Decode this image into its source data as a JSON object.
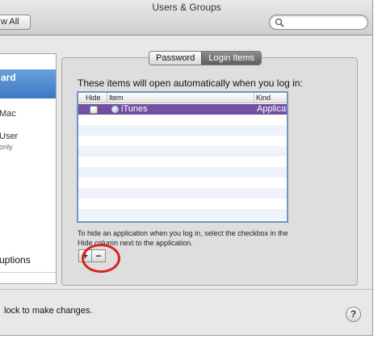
{
  "window": {
    "title": "Users & Groups"
  },
  "toolbar": {
    "show_all_label": "w All",
    "search_icon": "search-icon"
  },
  "sidebar": {
    "selected_label": "ard",
    "items": [
      {
        "label": "Mac",
        "sub": ""
      },
      {
        "label": "User",
        "sub": "only"
      }
    ],
    "options_label": "uptions"
  },
  "tabs": [
    {
      "label": "Password",
      "active": false
    },
    {
      "label": "Login Items",
      "active": true
    }
  ],
  "login_items": {
    "heading": "These items will open automatically when you log in:",
    "columns": [
      "Hide",
      "Item",
      "Kind"
    ],
    "rows": [
      {
        "hide_checked": false,
        "icon": "itunes-icon",
        "item": "iTunes",
        "kind": "Application",
        "selected": true
      }
    ],
    "hint": "To hide an application when you log in, select the checkbox in the Hide column next to the application.",
    "add_label": "+",
    "remove_label": "−"
  },
  "footer": {
    "lock_text": "lock to make changes.",
    "help_label": "?"
  },
  "colors": {
    "selection": "#7450a2",
    "sidebar_selection": "#4f88cf",
    "annotation": "#d6261c"
  }
}
